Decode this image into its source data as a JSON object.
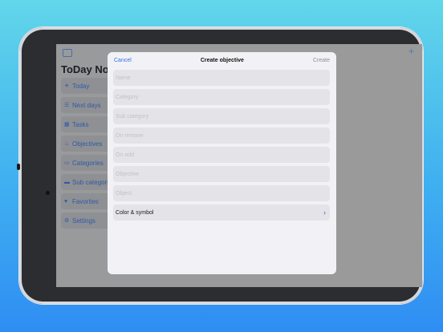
{
  "sidebar": {
    "title": "ToDay No",
    "items": [
      {
        "label": "Today",
        "icon": "sun-icon"
      },
      {
        "label": "Next days",
        "icon": "list-icon"
      },
      {
        "label": "Tasks",
        "icon": "calendar-icon"
      },
      {
        "label": "Objectives",
        "icon": "flame-icon"
      },
      {
        "label": "Categories",
        "icon": "card-icon"
      },
      {
        "label": "Sub categories",
        "icon": "tray-icon"
      },
      {
        "label": "Favorites",
        "icon": "heart-icon"
      },
      {
        "label": "Settings",
        "icon": "gear-icon"
      }
    ]
  },
  "modal": {
    "cancel_label": "Cancel",
    "title": "Create objective",
    "create_label": "Create",
    "fields": [
      {
        "placeholder": "Name"
      },
      {
        "placeholder": "Category"
      },
      {
        "placeholder": "Sub category"
      },
      {
        "placeholder": "On remove"
      },
      {
        "placeholder": "On add"
      },
      {
        "placeholder": "Objective"
      },
      {
        "placeholder": "Object"
      }
    ],
    "color_symbol_label": "Color & symbol"
  },
  "colors": {
    "accent": "#2f72e0",
    "background_gradient_top": "#62d6ea",
    "background_gradient_bottom": "#2f8df3"
  }
}
